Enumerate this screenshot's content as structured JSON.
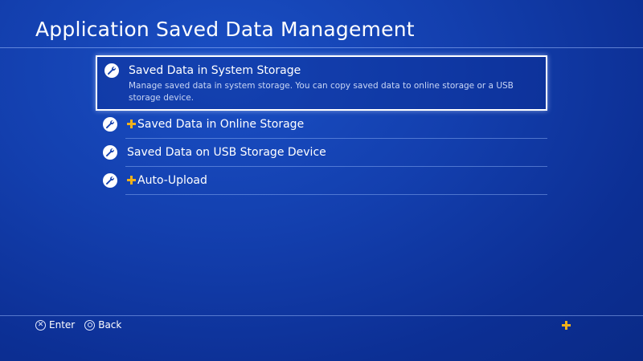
{
  "page": {
    "title": "Application Saved Data Management"
  },
  "menu": {
    "items": [
      {
        "label": "Saved Data in System Storage",
        "description": "Manage saved data in system storage. You can copy saved data to online storage or a USB storage device.",
        "icon": "wrench-icon",
        "plus_badge": false,
        "focused": true
      },
      {
        "label": "Saved Data in Online Storage",
        "icon": "wrench-icon",
        "plus_badge": true,
        "focused": false
      },
      {
        "label": "Saved Data on USB Storage Device",
        "icon": "wrench-icon",
        "plus_badge": false,
        "focused": false
      },
      {
        "label": "Auto-Upload",
        "icon": "wrench-icon",
        "plus_badge": true,
        "focused": false
      }
    ]
  },
  "footer": {
    "enter": {
      "glyph": "cross-button-icon",
      "label": "Enter"
    },
    "back": {
      "glyph": "circle-button-icon",
      "label": "Back"
    },
    "plus_icon": "ps-plus-icon"
  },
  "colors": {
    "background": "#133fae",
    "plus_accent": "#f2b11a",
    "focus_border": "#ffffff"
  }
}
